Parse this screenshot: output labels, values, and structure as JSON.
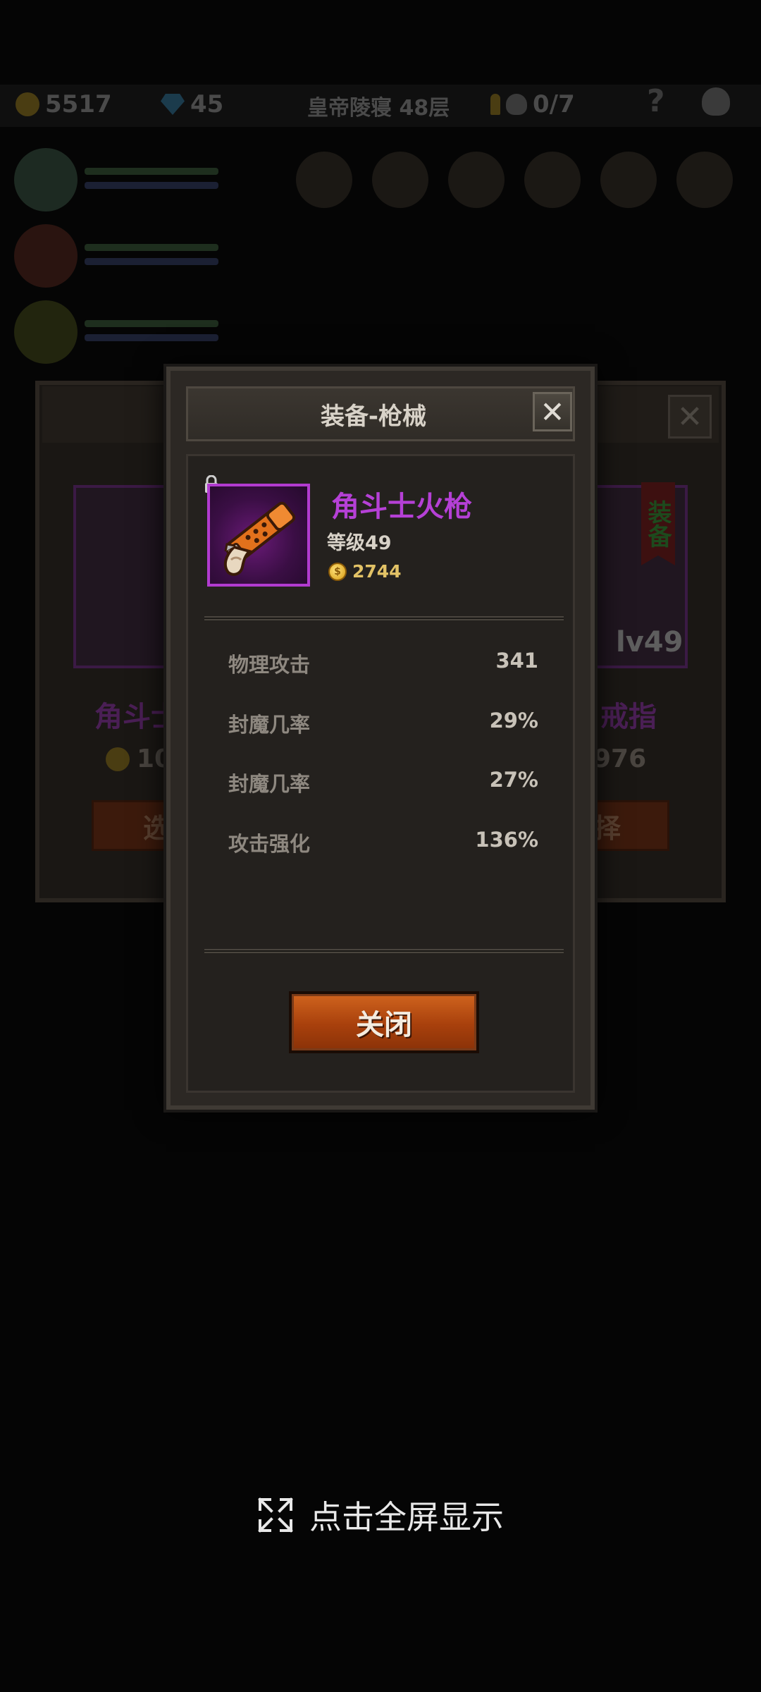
{
  "background": {
    "gold": "5517",
    "gems": "45",
    "location": "皇帝陵寝 48层",
    "kills": "0/7",
    "help": "?",
    "left_card": {
      "name": "角斗士",
      "price": "10",
      "button": "选"
    },
    "right_card": {
      "name": "戒指",
      "price": "976",
      "button": "择",
      "badge": "装备",
      "level": "lv49"
    }
  },
  "modal": {
    "title": "装备-枪械",
    "close_icon": "close-icon",
    "item": {
      "name": "角斗士火枪",
      "level": "等级49",
      "price": "2744",
      "rarity_color": "#b540d6"
    },
    "stats": [
      {
        "label": "物理攻击",
        "value": "341"
      },
      {
        "label": "封魔几率",
        "value": "29%"
      },
      {
        "label": "封魔几率",
        "value": "27%"
      },
      {
        "label": "攻击强化",
        "value": "136%"
      }
    ],
    "close_button": "关闭"
  },
  "fullscreen_hint": "点击全屏显示"
}
